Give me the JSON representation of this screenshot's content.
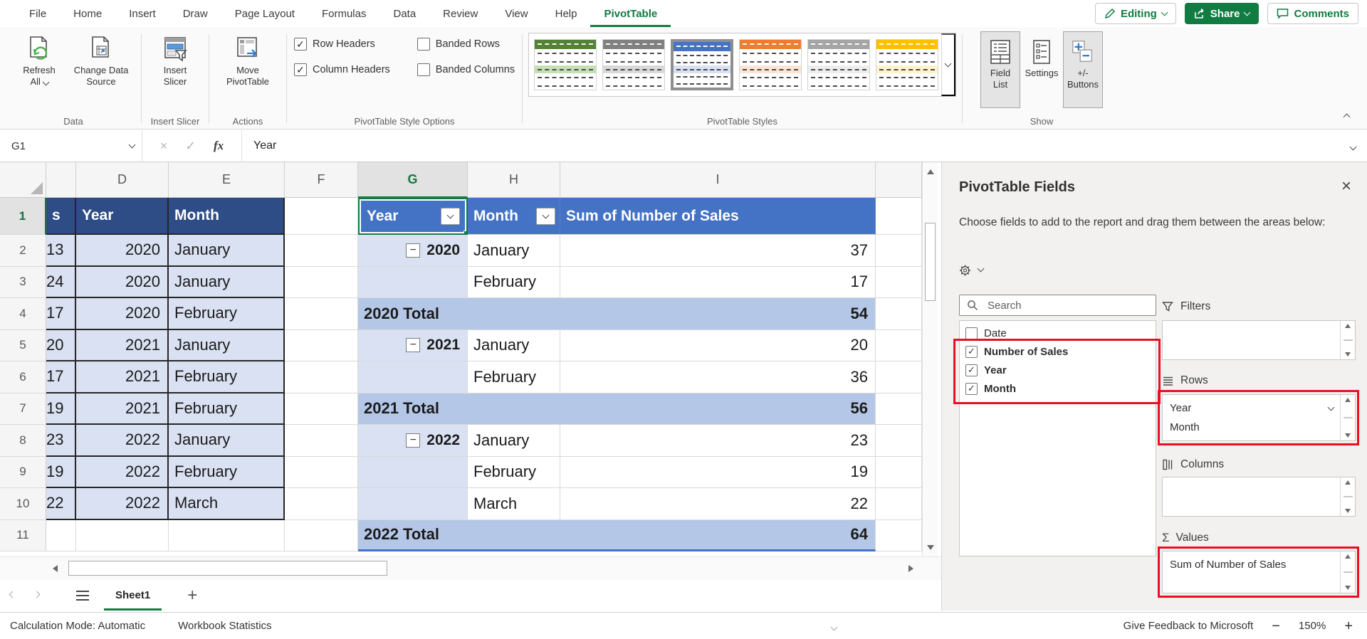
{
  "menu": {
    "items": [
      {
        "label": "File",
        "active": false
      },
      {
        "label": "Home",
        "active": false
      },
      {
        "label": "Insert",
        "active": false
      },
      {
        "label": "Draw",
        "active": false
      },
      {
        "label": "Page Layout",
        "active": false
      },
      {
        "label": "Formulas",
        "active": false
      },
      {
        "label": "Data",
        "active": false
      },
      {
        "label": "Review",
        "active": false
      },
      {
        "label": "View",
        "active": false
      },
      {
        "label": "Help",
        "active": false
      },
      {
        "label": "PivotTable",
        "active": true
      }
    ],
    "editing_label": "Editing",
    "share_label": "Share",
    "comments_label": "Comments"
  },
  "ribbon": {
    "refresh_all": {
      "line1": "Refresh",
      "line2": "All"
    },
    "change_data_source": {
      "line1": "Change Data",
      "line2": "Source"
    },
    "insert_slicer": {
      "line1": "Insert",
      "line2": "Slicer"
    },
    "move_pivottable": {
      "line1": "Move",
      "line2": "PivotTable"
    },
    "field_list": {
      "line1": "Field",
      "line2": "List"
    },
    "settings": {
      "line1": "Settings",
      "line2": ""
    },
    "plus_minus_buttons": {
      "line1": "+/-",
      "line2": "Buttons"
    },
    "style_options": [
      {
        "label": "Row Headers",
        "checked": true
      },
      {
        "label": "Column Headers",
        "checked": true
      },
      {
        "label": "Banded Rows",
        "checked": false
      },
      {
        "label": "Banded Columns",
        "checked": false
      }
    ],
    "groups": [
      "Data",
      "Insert Slicer",
      "Actions",
      "PivotTable Style Options",
      "PivotTable Styles",
      "Show"
    ],
    "styles_gallery": [
      {
        "name": "green",
        "header": "#538135",
        "band": "#C6E0B4",
        "selected": false
      },
      {
        "name": "gray",
        "header": "#808080",
        "band": "#D9D9D9",
        "selected": false
      },
      {
        "name": "blue",
        "header": "#4472C4",
        "band": "#D9E1F2",
        "selected": true
      },
      {
        "name": "orange",
        "header": "#ED7D31",
        "band": "#FCE4D6",
        "selected": false
      },
      {
        "name": "light-gray",
        "header": "#A5A5A5",
        "band": "#EDEDED",
        "selected": false
      },
      {
        "name": "yellow",
        "header": "#FFC000",
        "band": "#FFF2CC",
        "selected": false
      }
    ]
  },
  "formula_bar": {
    "cell_ref": "G1",
    "fx_label": "fx",
    "formula": "Year"
  },
  "grid": {
    "col_letters": [
      "",
      "",
      "D",
      "E",
      "F",
      "G",
      "H",
      "I",
      ""
    ],
    "active_col_index": 5,
    "row_numbers": [
      "1",
      "2",
      "3",
      "4",
      "5",
      "6",
      "7",
      "8",
      "9",
      "10",
      "11"
    ],
    "source": {
      "header_clipped": "s",
      "headers": [
        "Year",
        "Month"
      ],
      "rows": [
        {
          "sales": "13",
          "year": "2020",
          "month": "January"
        },
        {
          "sales": "24",
          "year": "2020",
          "month": "January"
        },
        {
          "sales": "17",
          "year": "2020",
          "month": "February"
        },
        {
          "sales": "20",
          "year": "2021",
          "month": "January"
        },
        {
          "sales": "17",
          "year": "2021",
          "month": "February"
        },
        {
          "sales": "19",
          "year": "2021",
          "month": "February"
        },
        {
          "sales": "23",
          "year": "2022",
          "month": "January"
        },
        {
          "sales": "19",
          "year": "2022",
          "month": "February"
        },
        {
          "sales": "22",
          "year": "2022",
          "month": "March"
        }
      ]
    },
    "pivot": {
      "headers": {
        "year": "Year",
        "month": "Month",
        "values": "Sum of Number of Sales"
      },
      "rows": [
        {
          "type": "year",
          "year": "2020",
          "month": "January",
          "value": "37"
        },
        {
          "type": "month",
          "month": "February",
          "value": "17"
        },
        {
          "type": "total",
          "label": "2020 Total",
          "value": "54"
        },
        {
          "type": "year",
          "year": "2021",
          "month": "January",
          "value": "20"
        },
        {
          "type": "month",
          "month": "February",
          "value": "36"
        },
        {
          "type": "total",
          "label": "2021 Total",
          "value": "56"
        },
        {
          "type": "year",
          "year": "2022",
          "month": "January",
          "value": "23"
        },
        {
          "type": "month",
          "month": "February",
          "value": "19"
        },
        {
          "type": "month",
          "month": "March",
          "value": "22"
        },
        {
          "type": "total",
          "label": "2022 Total",
          "value": "64"
        }
      ]
    }
  },
  "panel": {
    "title": "PivotTable Fields",
    "description": "Choose fields to add to the report and drag them between the areas below:",
    "search_placeholder": "Search",
    "fields": [
      {
        "label": "Date",
        "checked": false
      },
      {
        "label": "Number of Sales",
        "checked": true
      },
      {
        "label": "Year",
        "checked": true
      },
      {
        "label": "Month",
        "checked": true
      }
    ],
    "areas": {
      "filters": {
        "label": "Filters",
        "items": []
      },
      "rows": {
        "label": "Rows",
        "items": [
          "Year",
          "Month"
        ]
      },
      "columns": {
        "label": "Columns",
        "items": []
      },
      "values": {
        "label": "Values",
        "items": [
          "Sum of Number of Sales"
        ]
      }
    }
  },
  "sheet_bar": {
    "tabs": [
      {
        "label": "Sheet1",
        "active": true
      }
    ]
  },
  "status_bar": {
    "calculation_mode": "Calculation Mode: Automatic",
    "workbook_statistics": "Workbook Statistics",
    "feedback": "Give Feedback to Microsoft",
    "zoom_level": "150%"
  },
  "colors": {
    "accent_green": "#107C41",
    "highlight_red": "#E81123",
    "source_header_bg": "#2E4C85",
    "source_cell_bg": "#D9E1F2",
    "pivot_header_bg": "#4472C4",
    "pivot_group_bg": "#D9E1F2",
    "pivot_total_bg": "#B4C7E7",
    "table_border": "#262626"
  }
}
